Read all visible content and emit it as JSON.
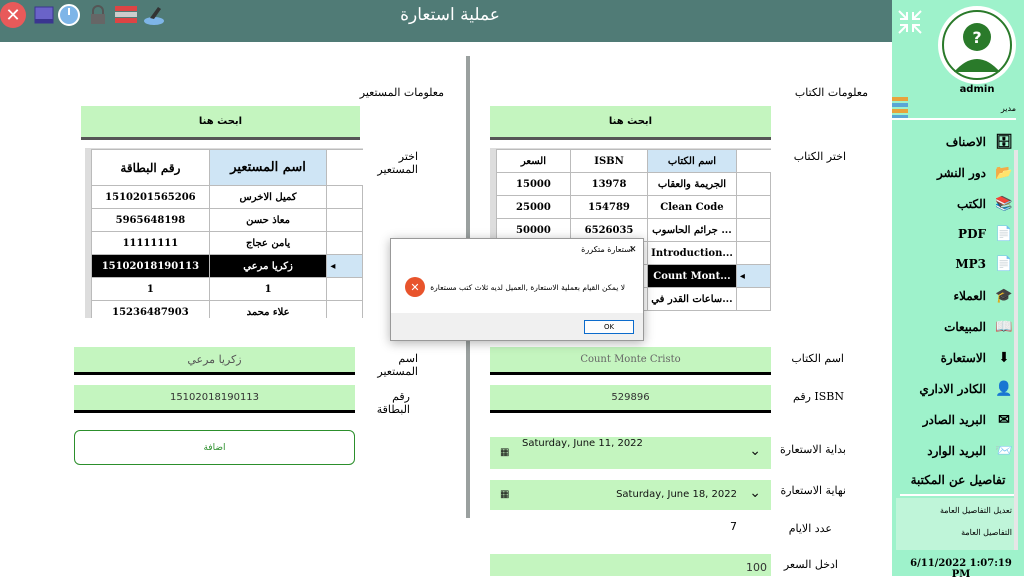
{
  "window": {
    "title": "عملية استعارة"
  },
  "member_section": {
    "title": "معلومات المستعير",
    "search_label": "ابحث هنا",
    "choose_label": "اختر المستعير",
    "columns": [
      "رقم البطاقة",
      "اسم المستعير"
    ],
    "rows": [
      [
        "1510201565206",
        "كميل الاخرس"
      ],
      [
        "5965648198",
        "معاذ حسن"
      ],
      [
        "11111111",
        "يامن عجاج"
      ],
      [
        "15102018190113",
        "زكريا مرعي"
      ],
      [
        "1",
        "1"
      ],
      [
        "15236487903",
        "علاء محمد"
      ]
    ],
    "name_label": "اسم المستعير",
    "name_value": "زكريا مرعي",
    "card_label": "رقم البطاقة",
    "card_value": "15102018190113",
    "add_button": "اضافة"
  },
  "book_section": {
    "title": "معلومات الكتاب",
    "search_label": "ابحث هنا",
    "choose_label": "اختر الكتاب",
    "columns": [
      "السعر",
      "ISBN",
      "اسم الكتاب"
    ],
    "rows": [
      [
        "15000",
        "13978",
        "الجريمة والعقاب"
      ],
      [
        "25000",
        "154789",
        "Clean Code"
      ],
      [
        "50000",
        "6526035",
        "جرائم الحاسوب ..."
      ],
      [
        "",
        "",
        "Introduction..."
      ],
      [
        "",
        "",
        "Count Mont..."
      ],
      [
        "",
        "",
        "ساعات القدر في..."
      ]
    ],
    "book_name_label": "اسم الكتاب",
    "book_name_value": "Count Monte Cristo",
    "isbn_label": "رقم ISBN",
    "isbn_value": "529896",
    "start_label": "بداية الاستعارة",
    "start_value": "Saturday, June 11, 2022",
    "end_label": "نهاية الاستعارة",
    "end_value": "Saturday, June 18, 2022",
    "days_label": "عدد الايام",
    "days_value": "7",
    "price_label": "ادخل السعر",
    "price_value": "100"
  },
  "dialog": {
    "title": "استعارة متكررة",
    "message": "لا يمكن القيام بعملية الاستعارة ,العميل لديه ثلاث كتب مستعارة",
    "ok": "OK",
    "close": "✕"
  },
  "sidebar": {
    "user_name": "admin",
    "user_role": "مدير",
    "items": [
      {
        "label": "الاصناف",
        "icon": "🗄"
      },
      {
        "label": "دور النشر",
        "icon": "📂"
      },
      {
        "label": "الكتب",
        "icon": "📚"
      },
      {
        "label": "PDF",
        "icon": "📄"
      },
      {
        "label": "MP3",
        "icon": "📄"
      },
      {
        "label": "العملاء",
        "icon": "🎓"
      },
      {
        "label": "المبيعات",
        "icon": "📖"
      },
      {
        "label": "الاستعارة",
        "icon": "⬇"
      },
      {
        "label": "الكادر الاداري",
        "icon": "👤"
      },
      {
        "label": "البريد الصادر",
        "icon": "✉"
      },
      {
        "label": "البريد الوارد",
        "icon": "📨"
      }
    ],
    "library_details": "تفاصيل عن المكتبة",
    "sub_items": [
      "تعديل التفاصيل العامة",
      "التفاصيل العامة"
    ],
    "datetime": "6/11/2022 1:07:19 PM"
  },
  "colors": {
    "accent_green": "#c4f5bf",
    "titlebar": "#507b76",
    "sidebar": "#9ef2cb",
    "close_red": "#e85a5a"
  }
}
